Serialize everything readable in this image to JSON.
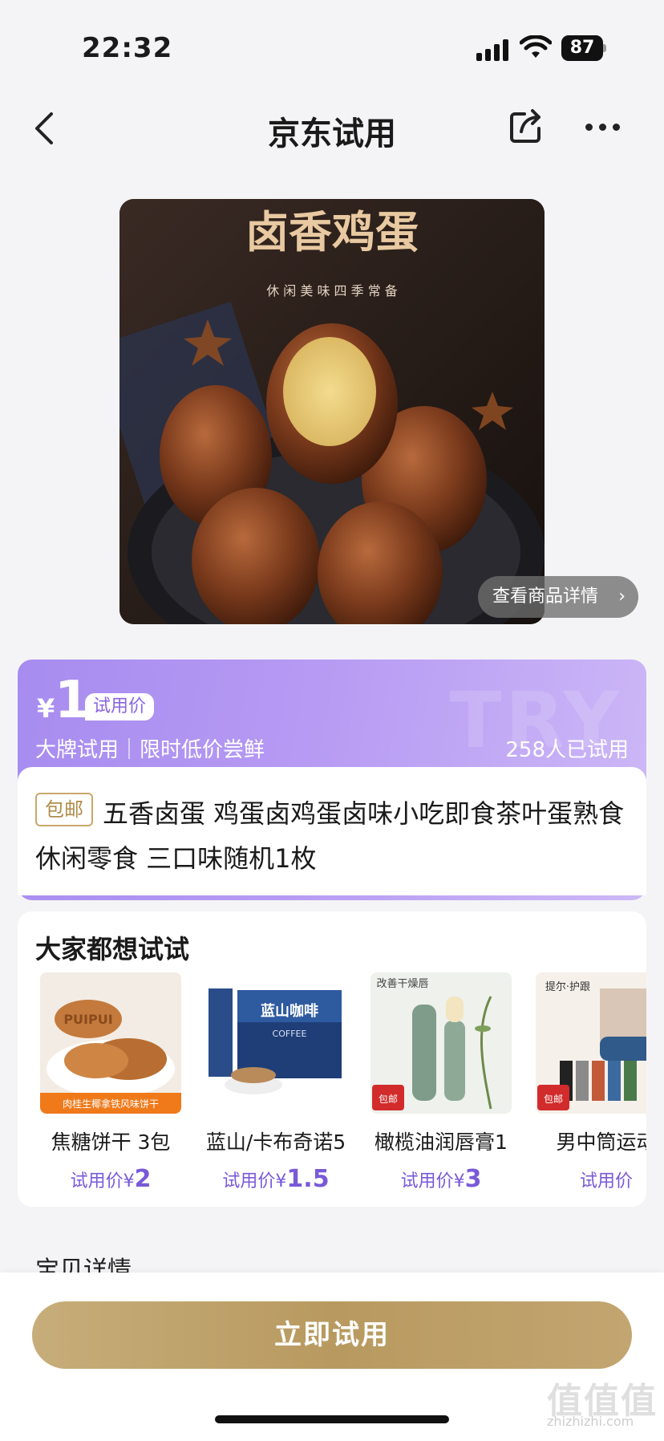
{
  "status": {
    "time": "22:32",
    "battery": "87"
  },
  "nav": {
    "title": "京东试用"
  },
  "product": {
    "image_title": "卤香鸡蛋",
    "image_subtitle": "休 闲 美 味    四 季 常 备",
    "view_detail": "查看商品详情",
    "detail_chevron": "›"
  },
  "price": {
    "currency": "¥",
    "value": "1",
    "tag": "试用价",
    "brand_line": "大牌试用｜限时低价尝鲜",
    "tried_count": "258人已试用",
    "watermark": "TRY"
  },
  "title": {
    "free_shipping": "包邮",
    "text": "五香卤蛋 鸡蛋卤鸡蛋卤味小吃即食茶叶蛋熟食休闲零食 三口味随机1枚"
  },
  "recommendations": {
    "heading": "大家都想试试",
    "items": [
      {
        "name": "焦糖饼干 3包",
        "price_label": "试用价¥",
        "price": "2",
        "thumb_text": "PUIPUI",
        "thumb_banner": "肉桂生椰拿铁风味饼干"
      },
      {
        "name": "蓝山/卡布奇诺5",
        "price_label": "试用价¥",
        "price": "1.5",
        "thumb_text": "蓝山咖啡",
        "thumb_banner": "COFFEE"
      },
      {
        "name": "橄榄油润唇膏1",
        "price_label": "试用价¥",
        "price": "3",
        "thumb_text": "改善干燥唇",
        "thumb_banner": "包邮"
      },
      {
        "name": "男中筒运动",
        "price_label": "试用价",
        "price": "",
        "thumb_text": "提尔·护跟",
        "thumb_banner": "包邮"
      }
    ]
  },
  "section": {
    "detail_title": "宝贝详情"
  },
  "cta": {
    "label": "立即试用"
  },
  "watermark": {
    "mark": "值值值",
    "url": "zhizhizhi.com"
  },
  "colors": {
    "accent_purple": "#a78cf0",
    "gold": "#c2a570"
  }
}
